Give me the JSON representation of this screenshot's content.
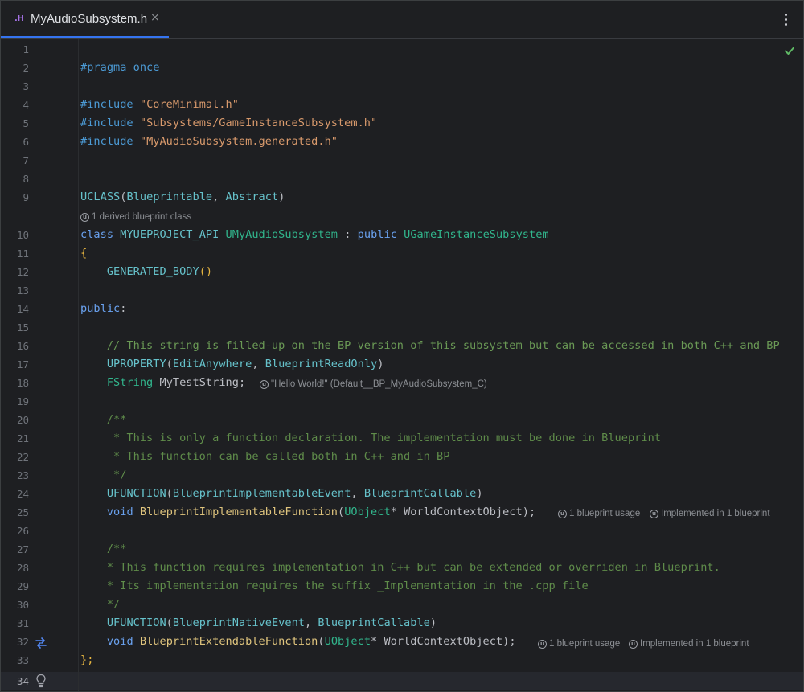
{
  "tab": {
    "type_icon": ".H",
    "title": "MyAudioSubsystem.h",
    "close": "×"
  },
  "line_numbers": [
    "1",
    "2",
    "3",
    "4",
    "5",
    "6",
    "7",
    "8",
    "9",
    "10",
    "11",
    "12",
    "13",
    "14",
    "15",
    "16",
    "17",
    "18",
    "19",
    "20",
    "21",
    "22",
    "23",
    "24",
    "25",
    "26",
    "27",
    "28",
    "29",
    "30",
    "31",
    "32",
    "33",
    "34"
  ],
  "code": {
    "l2_pp": "#pragma once",
    "l4_pp": "#include",
    "l4_str": "\"CoreMinimal.h\"",
    "l5_pp": "#include",
    "l5_str": "\"Subsystems/GameInstanceSubsystem.h\"",
    "l6_pp": "#include",
    "l6_str": "\"MyAudioSubsystem.generated.h\"",
    "l9_macro": "UCLASS",
    "l9_args_a": "Blueprintable",
    "l9_args_b": "Abstract",
    "l10_kw": "class",
    "l10_api": "MYUEPROJECT_API",
    "l10_name": "UMyAudioSubsystem",
    "l10_colon": ":",
    "l10_pub": "public",
    "l10_base": "UGameInstanceSubsystem",
    "l11": "{",
    "l12": "GENERATED_BODY",
    "l14": "public",
    "l16": "// This string is filled-up on the BP version of this subsystem but can be accessed in both C++ and BP",
    "l17_macro": "UPROPERTY",
    "l17_a": "EditAnywhere",
    "l17_b": "BlueprintReadOnly",
    "l18_type": "FString",
    "l18_name": "MyTestString",
    "l20": "/**",
    "l21": " * This is only a function declaration. The implementation must be done in Blueprint",
    "l22": " * This function can be called both in C++ and in BP",
    "l23": " */",
    "l24_macro": "UFUNCTION",
    "l24_a": "BlueprintImplementableEvent",
    "l24_b": "BlueprintCallable",
    "l25_kw": "void",
    "l25_fn": "BlueprintImplementableFunction",
    "l25_type": "UObject",
    "l25_param": "WorldContextObject",
    "l27": "/**",
    "l28": "* This function requires implementation in C++ but can be extended or overriden in Blueprint.",
    "l29": "* Its implementation requires the suffix _Implementation in the .cpp file",
    "l30": "*/",
    "l31_macro": "UFUNCTION",
    "l31_a": "BlueprintNativeEvent",
    "l31_b": "BlueprintCallable",
    "l32_kw": "void",
    "l32_fn": "BlueprintExtendableFunction",
    "l32_type": "UObject",
    "l32_param": "WorldContextObject",
    "l33": "};"
  },
  "hints": {
    "derived_class": "1 derived blueprint class",
    "test_string_value": "\"Hello World!\" (Default__BP_MyAudioSubsystem_C)",
    "l25_usage": "1 blueprint usage",
    "l25_impl": "Implemented in 1 blueprint",
    "l32_usage": "1 blueprint usage",
    "l32_impl": "Implemented in 1 blueprint"
  },
  "icons": {
    "tab_menu": "more-vertical-icon",
    "status": "check-icon",
    "gutter_32": "implementation-swap-icon",
    "gutter_34": "lightbulb-icon",
    "hint": "unreal-engine-icon"
  },
  "colors": {
    "background": "#1e1f22",
    "accent": "#3574f0",
    "comment": "#6a9955",
    "string": "#d99a6c",
    "keyword": "#6aa2f0"
  }
}
